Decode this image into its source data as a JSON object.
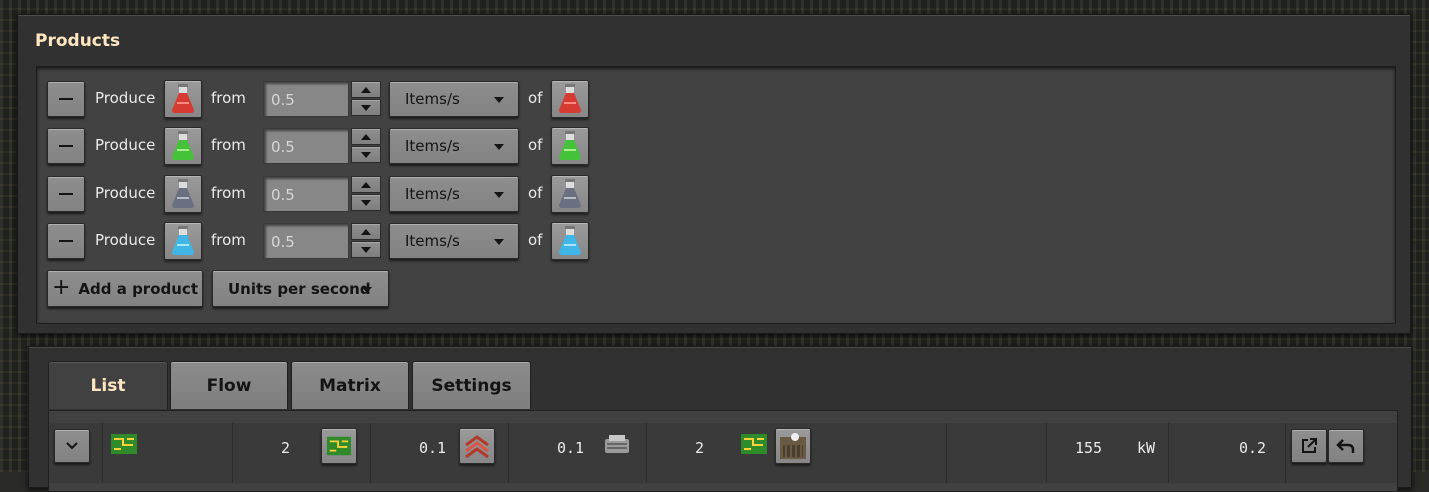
{
  "products": {
    "title": "Products",
    "rows": [
      {
        "verb": "Produce",
        "item_icon": "red-science-pack-icon",
        "from": "from",
        "amount": "0.5",
        "unit": "Items/s",
        "of": "of",
        "of_icon": "red-science-pack-icon"
      },
      {
        "verb": "Produce",
        "item_icon": "green-science-pack-icon",
        "from": "from",
        "amount": "0.5",
        "unit": "Items/s",
        "of": "of",
        "of_icon": "green-science-pack-icon"
      },
      {
        "verb": "Produce",
        "item_icon": "military-science-pack-icon",
        "from": "from",
        "amount": "0.5",
        "unit": "Items/s",
        "of": "of",
        "of_icon": "military-science-pack-icon"
      },
      {
        "verb": "Produce",
        "item_icon": "chemical-science-pack-icon",
        "from": "from",
        "amount": "0.5",
        "unit": "Items/s",
        "of": "of",
        "of_icon": "chemical-science-pack-icon"
      }
    ],
    "add_button": "Add a product",
    "timescale": "Units per second"
  },
  "colors": {
    "red_pack": "#d63a32",
    "green_pack": "#46c23a",
    "grey_pack": "#8a8f99",
    "blue_pack": "#3fb6e6",
    "title": "#ffe6c0"
  },
  "tabs": [
    {
      "label": "List",
      "active": true
    },
    {
      "label": "Flow",
      "active": false
    },
    {
      "label": "Matrix",
      "active": false
    },
    {
      "label": "Settings",
      "active": false
    }
  ],
  "list_row": {
    "expand_icon": "chevron-down-icon",
    "recipe_icon": "electronic-circuit-icon",
    "building_count": "2",
    "building_icon": "electronic-circuit-icon",
    "beacon_value": "0.1",
    "beacon_icon": "speed-module-icon",
    "module_value": "0.1",
    "module_icon": "engine-unit-icon",
    "ingredient_count": "2",
    "ingredient_icons": [
      "electronic-circuit-icon",
      "assembling-machine-icon"
    ],
    "power_value": "155",
    "power_unit": "kW",
    "pollution_value": "0.2",
    "actions": [
      "open-external-icon",
      "undo-icon"
    ]
  }
}
